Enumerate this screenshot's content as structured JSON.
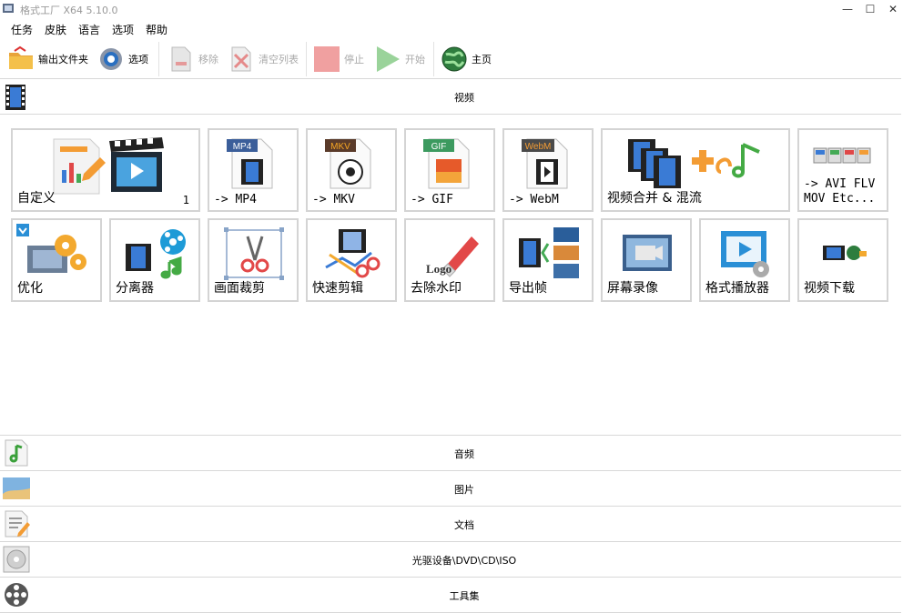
{
  "window": {
    "title": "格式工厂 X64 5.10.0",
    "minimize": "—",
    "maximize": "☐",
    "close": "✕"
  },
  "menu": {
    "items": [
      "任务",
      "皮肤",
      "语言",
      "选项",
      "帮助"
    ]
  },
  "toolbar": {
    "output_folder": "输出文件夹",
    "options": "选项",
    "remove": "移除",
    "clear_list": "清空列表",
    "stop": "停止",
    "start": "开始",
    "home": "主页"
  },
  "sections": {
    "video": "视频",
    "audio": "音频",
    "image": "图片",
    "document": "文档",
    "rom": "光驱设备\\DVD\\CD\\ISO",
    "tools": "工具集"
  },
  "tiles_row1": [
    {
      "label": "自定义",
      "count": "1"
    },
    {
      "label": "-> MP4",
      "badge": "MP4"
    },
    {
      "label": "-> MKV",
      "badge": "MKV"
    },
    {
      "label": "-> GIF",
      "badge": "GIF"
    },
    {
      "label": "-> WebM",
      "badge": "WebM"
    },
    {
      "label": "视频合并 & 混流"
    },
    {
      "label": "-> AVI FLV MOV Etc..."
    }
  ],
  "tiles_row2": [
    {
      "label": "优化"
    },
    {
      "label": "分离器"
    },
    {
      "label": "画面裁剪"
    },
    {
      "label": "快速剪辑"
    },
    {
      "label": "去除水印",
      "art_text": "Logo"
    },
    {
      "label": "导出帧"
    },
    {
      "label": "屏幕录像"
    },
    {
      "label": "格式播放器"
    },
    {
      "label": "视频下载"
    }
  ]
}
